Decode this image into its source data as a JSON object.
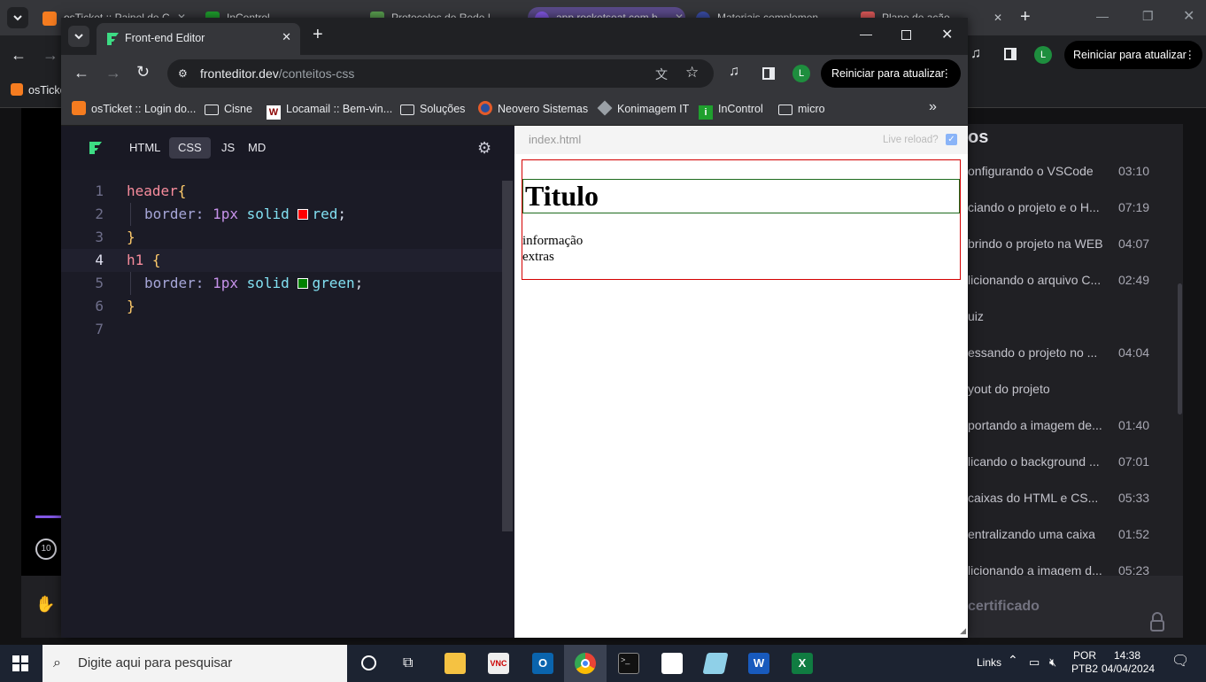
{
  "back_window": {
    "tabs": [
      {
        "label": "osTicket :: Painel de C...",
        "color": "#f57c20"
      },
      {
        "label": "InControl",
        "color": "#1fa02e"
      },
      {
        "label": "Protocolos de Rede | ...",
        "color": "#5aa050"
      },
      {
        "label": "app.rocketseat.com.b...",
        "color": "#8257e5"
      },
      {
        "label": "Materiais complemen...",
        "color": "#3b4ea8"
      },
      {
        "label": "Plano de ação...",
        "color": "#e05a5a"
      }
    ],
    "update_label": "Reiniciar para atualizar",
    "avatar_letter": "L",
    "bookmark_first": "osTicke"
  },
  "course": {
    "header": "os",
    "lessons": [
      {
        "title": "onfigurando o VSCode",
        "time": "03:10"
      },
      {
        "title": "ciando o projeto e o H...",
        "time": "07:19"
      },
      {
        "title": "brindo o projeto na WEB",
        "time": "04:07"
      },
      {
        "title": "licionando o arquivo C...",
        "time": "02:49"
      },
      {
        "title": "uiz",
        "time": ""
      },
      {
        "title": "essando o projeto no ...",
        "time": "04:04"
      },
      {
        "title": "yout do projeto",
        "time": ""
      },
      {
        "title": "portando a imagem de...",
        "time": "01:40"
      },
      {
        "title": "licando o background ...",
        "time": "07:01"
      },
      {
        "title": "caixas do HTML e CS...",
        "time": "05:33"
      },
      {
        "title": "entralizando uma caixa",
        "time": "01:52"
      },
      {
        "title": "licionando a imagem d...",
        "time": "05:23"
      }
    ],
    "certificate": "certificado",
    "replay_label": "10"
  },
  "front_window": {
    "tab_title": "Front-end Editor",
    "url_host": "fronteditor.dev",
    "url_path": "/conteitos-css",
    "update_label": "Reiniciar para atualizar",
    "avatar_letter": "L",
    "bookmarks": [
      {
        "label": "osTicket :: Login do...",
        "icon": "osticket-icon"
      },
      {
        "label": "Cisne",
        "icon": "folder-icon"
      },
      {
        "label": "Locamail :: Bem-vin...",
        "icon": "locamail-icon"
      },
      {
        "label": "Soluções",
        "icon": "folder-icon"
      },
      {
        "label": "Neovero Sistemas",
        "icon": "neovero-icon"
      },
      {
        "label": "Konimagem IT",
        "icon": "konimagem-icon"
      },
      {
        "label": "InControl",
        "icon": "incontrol-icon"
      },
      {
        "label": "micro",
        "icon": "folder-icon"
      }
    ]
  },
  "editor": {
    "tabs": [
      "HTML",
      "CSS",
      "JS",
      "MD"
    ],
    "active_tab": "CSS",
    "line_numbers": [
      "1",
      "2",
      "3",
      "4",
      "5",
      "6",
      "7"
    ],
    "code": {
      "l1_selector": "header",
      "l1_brace": "{",
      "l2_prop": "border:",
      "l2_num": "1px",
      "l2_style": "solid",
      "l2_color": "red",
      "l2_semicolon": ";",
      "l3_brace": "}",
      "l4_selector": "h1",
      "l4_brace": "{",
      "l5_prop": "border:",
      "l5_num": "1px",
      "l5_style": "solid",
      "l5_color": "green",
      "l5_semicolon": ";",
      "l6_brace": "}"
    },
    "swatch_red": "#ff0000",
    "swatch_green": "#008000"
  },
  "preview": {
    "file_name": "index.html",
    "live_reload_label": "Live reload?",
    "live_reload_checked": true,
    "h1": "Titulo",
    "line1": "informação",
    "line2": "extras"
  },
  "taskbar": {
    "search_placeholder": "Digite aqui para pesquisar",
    "links_label": "Links",
    "lang": "POR",
    "layout": "PTB2",
    "time": "14:38",
    "date": "04/04/2024"
  }
}
